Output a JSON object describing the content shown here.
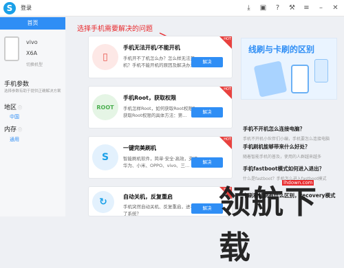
{
  "titlebar": {
    "login_label": "登录"
  },
  "left": {
    "tab_home": "首页",
    "brand": "vivo",
    "model": "X6A",
    "switch_label": "切换机型",
    "params_title": "手机参数",
    "params_sub": "选择参数有助于提供正确解决方案",
    "region_label": "地区",
    "region_value": "中国",
    "memory_label": "内存",
    "memory_value": "通用"
  },
  "annotation": "选择手机需要解决的问题",
  "cards": [
    {
      "title": "手机无法开机/不能开机",
      "desc": "手机开不了机怎么办？怎么样无法开机？手机不能开机的原因及解决办法",
      "btn": "解决",
      "hot": "HOT",
      "icon": "phone-icon"
    },
    {
      "title": "手机Root，获取权限",
      "desc": "手机怎样Root，如何获取Root权限？获取Root权限的具体方法：第…",
      "btn": "解决",
      "hot": "HOT",
      "icon": "root-icon"
    },
    {
      "title": "一键完美刷机",
      "desc": "智能刷机软件，简单·安全·高效，支持华为、小米、OPPO、vivo、三…",
      "btn": "解决",
      "hot": "HOT",
      "icon": "flash-icon"
    },
    {
      "title": "自动关机，反复重启",
      "desc": "手机突然自动关机、反复重启，进不了系统？",
      "btn": "解决",
      "hot": "HOT",
      "icon": "restart-icon"
    }
  ],
  "banner": {
    "title": "线刷与卡刷的区别"
  },
  "qa": [
    {
      "q": "手机不开机怎么连接电脑？",
      "a": "手机不开机小伙伴们小编，手机要怎么连接电脑"
    },
    {
      "q": "手机刷机能够带来什么好处？",
      "a": "随着智能手机的普及，使用的人群越来越多"
    },
    {
      "q": "手机fastboot模式如何进入退出？",
      "a": "什么是fastboot？手机怎么进入fastboot模式"
    },
    {
      "q": "卡刷和线刷有什么区别，recovery模式",
      "a": ""
    }
  ],
  "watermark": {
    "text": "领航下载",
    "url": "lhdown.com"
  }
}
